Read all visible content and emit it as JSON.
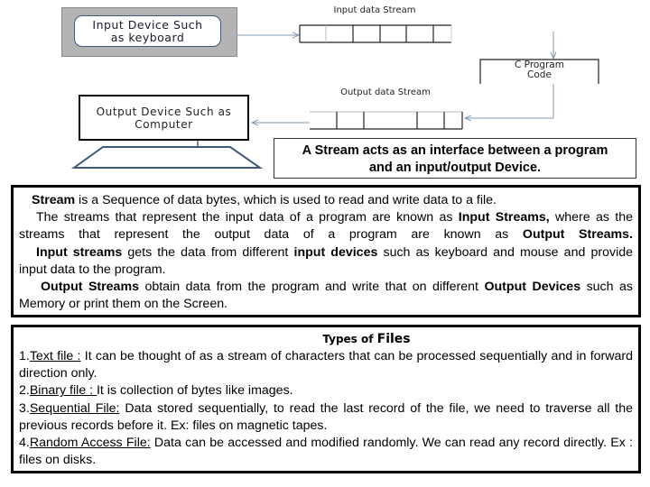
{
  "diagram": {
    "input_device": {
      "line1": "Input Device Such",
      "line2": "as keyboard"
    },
    "input_stream_label": "Input data Stream",
    "program_box": {
      "line1": "C Program",
      "line2": "Code"
    },
    "output_stream_label": "Output data Stream",
    "output_device": {
      "line1": "Output Device Such as",
      "line2": "Computer"
    },
    "caption": {
      "line1": "A Stream acts as an interface between a program",
      "line2": "and an input/output Device."
    }
  },
  "streams_panel": {
    "p1": {
      "bold": "Stream",
      "rest": " is a Sequence of data bytes, which is used to read and write data to a file."
    },
    "p2": {
      "a": "The streams that represent the input data of a program are known as ",
      "b": "Input Streams,",
      "c": " where as the streams that represent the output data of a program are known as ",
      "d": "Output Streams."
    },
    "p3": {
      "a": "Input  streams",
      "b": " gets the data from different ",
      "c": "input devices",
      "d": " such as keyboard and mouse and provide input data to the program."
    },
    "p4": {
      "a": "Output Streams",
      "b": " obtain data from the program and  write that on different ",
      "c": "Output Devices",
      "d": " such as Memory or print them on the Screen."
    }
  },
  "files_panel": {
    "title_small": "Types of ",
    "title_big": "Files",
    "items": [
      {
        "num": "1.",
        "label": "Text file :",
        "text": " It can be thought of as a stream of characters that can be processed sequentially and in forward direction only."
      },
      {
        "num": "2.",
        "label": "Binary file : ",
        "text": "It is collection of bytes like images."
      },
      {
        "num": "3.",
        "label": "Sequential File:",
        "text": " Data stored sequentially, to read the last record of the file, we need to traverse all the previous records before it. Ex: files on magnetic tapes."
      },
      {
        "num": "4.",
        "label": "Random Access File:",
        "text": " Data can be accessed and modified randomly. We can read any record directly.  Ex : files on disks."
      }
    ]
  }
}
